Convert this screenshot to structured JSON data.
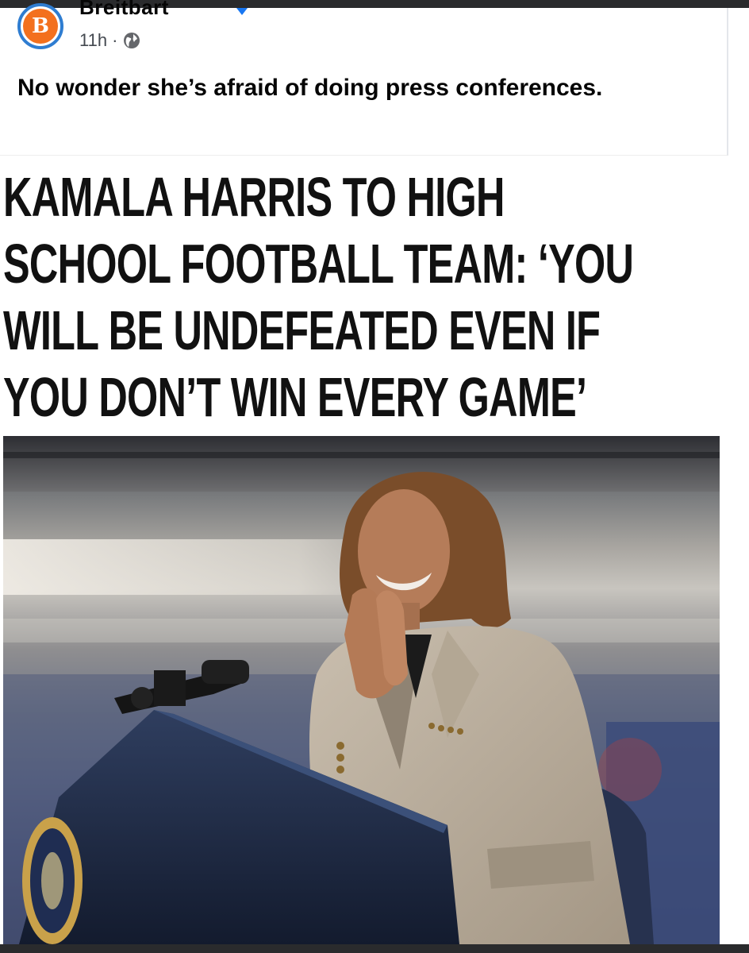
{
  "post": {
    "page_name": "Breitbart",
    "avatar_letter": "B",
    "time": "11h",
    "separator": "·",
    "text": "No wonder she’s afraid of doing press conferences."
  },
  "article": {
    "headline_lines": [
      "KAMALA HARRIS TO HIGH",
      "SCHOOL FOOTBALL TEAM: ‘YOU",
      "WILL BE UNDEFEATED EVEN IF",
      "YOU DON’T WIN EVERY GAME’"
    ]
  },
  "colors": {
    "avatar_ring": "#2f7dd1",
    "avatar_fill": "#f3701e",
    "verified": "#1877f2",
    "podium": "#1c2740",
    "blazer": "#b7ab9b"
  },
  "icons": {
    "globe": "globe-icon",
    "verified": "verified-badge-icon"
  }
}
